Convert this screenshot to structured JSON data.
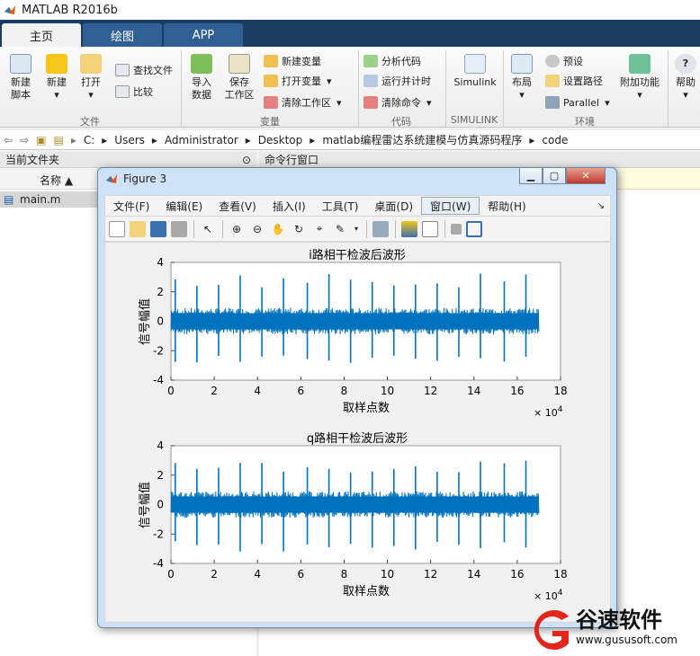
{
  "window": {
    "title": "MATLAB R2016b"
  },
  "tabs": [
    {
      "label": "主页"
    },
    {
      "label": "绘图"
    },
    {
      "label": "APP"
    }
  ],
  "ribbon": {
    "new_script": "新建\n脚本",
    "new": "新建",
    "open": "打开",
    "find_files": "查找文件",
    "compare": "比较",
    "import": "导入\n数据",
    "save_ws": "保存\n工作区",
    "new_var": "新建变量",
    "open_var": "打开变量",
    "clear_ws": "清除工作区",
    "analyze": "分析代码",
    "run_time": "运行并计时",
    "clear_cmd": "清除命令",
    "simulink": "Simulink",
    "layout": "布局",
    "prefs": "预设",
    "set_path": "设置路径",
    "parallel": "Parallel",
    "addons": "附加功能",
    "help": "帮助",
    "sections": {
      "file": "文件",
      "variable": "变量",
      "code": "代码",
      "simulink": "SIMULINK",
      "env": "环境"
    }
  },
  "address": {
    "parts": [
      "C:",
      "Users",
      "Administrator",
      "Desktop",
      "matlab编程雷达系统建模与仿真源码程序",
      "code"
    ]
  },
  "left_panel": {
    "title": "当前文件夹",
    "col_name": "名称 ▲",
    "file": "main.m"
  },
  "cmd_panel": {
    "title": "命令行窗口"
  },
  "figure": {
    "title": "Figure 3",
    "menus": [
      "文件(F)",
      "编辑(E)",
      "查看(V)",
      "插入(I)",
      "工具(T)",
      "桌面(D)",
      "窗口(W)",
      "帮助(H)"
    ],
    "plots": [
      {
        "title": "i路相干检波后波形",
        "ylabel": "信号幅值",
        "xlabel": "取样点数"
      },
      {
        "title": "q路相干检波后波形",
        "ylabel": "信号幅值",
        "xlabel": "取样点数"
      }
    ],
    "exponent": "× 10",
    "exp_power": "4"
  },
  "chart_data": [
    {
      "type": "line",
      "title": "i路相干检波后波形",
      "xlabel": "取样点数",
      "ylabel": "信号幅值",
      "xlim": [
        0,
        18
      ],
      "ylim": [
        -4,
        4
      ],
      "xticks": [
        0,
        2,
        4,
        6,
        8,
        10,
        12,
        14,
        16,
        18
      ],
      "yticks": [
        -4,
        -2,
        0,
        2,
        4
      ],
      "x_scale_exponent": 4,
      "series": [
        {
          "color": "#0072bd",
          "noise_band": [
            -0.9,
            0.9
          ],
          "spike_positions": [
            0.2,
            1.2,
            2.2,
            3.2,
            4.2,
            5.2,
            6.3,
            7.3,
            8.3,
            9.3,
            10.3,
            11.3,
            12.3,
            13.3,
            14.3,
            15.4,
            16.4
          ],
          "spike_max": 3.3,
          "spike_min": -3.0
        }
      ]
    },
    {
      "type": "line",
      "title": "q路相干检波后波形",
      "xlabel": "取样点数",
      "ylabel": "信号幅值",
      "xlim": [
        0,
        18
      ],
      "ylim": [
        -4,
        4
      ],
      "xticks": [
        0,
        2,
        4,
        6,
        8,
        10,
        12,
        14,
        16,
        18
      ],
      "yticks": [
        -4,
        -2,
        0,
        2,
        4
      ],
      "x_scale_exponent": 4,
      "series": [
        {
          "color": "#0072bd",
          "noise_band": [
            -0.9,
            0.9
          ],
          "spike_positions": [
            0.2,
            1.2,
            2.2,
            3.2,
            4.2,
            5.2,
            6.3,
            7.3,
            8.3,
            9.3,
            10.3,
            11.3,
            12.3,
            13.3,
            14.3,
            15.4,
            16.4
          ],
          "spike_max": 3.0,
          "spike_min": -3.2
        }
      ]
    }
  ],
  "watermark": {
    "brand": "谷速软件",
    "url": "www.gususoft.com"
  }
}
